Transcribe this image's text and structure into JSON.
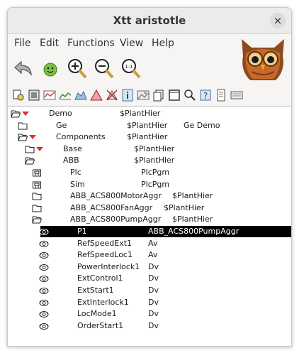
{
  "window": {
    "title": "Xtt aristotle",
    "close_glyph": "×"
  },
  "menu": [
    "File",
    "Edit",
    "Functions",
    "View",
    "Help"
  ],
  "toolbar_big": [
    "back-icon",
    "smiley-icon",
    "zoom-in-icon",
    "zoom-out-icon",
    "zoom-reset-icon"
  ],
  "toolbar_small": [
    "open-object-icon",
    "open-graph-icon",
    "trend-icon",
    "fast-curve-icon",
    "history-icon",
    "alarm-icon",
    "block-alarm-icon",
    "info-icon",
    "open-plc-icon",
    "crossref-icon",
    "window-icon",
    "plc-crossref-icon",
    "help-icon",
    "notes-icon",
    "keyboard-icon"
  ],
  "tree": [
    {
      "name": "Demo",
      "class": "$PlantHier",
      "desc": "",
      "icon": "folder-open",
      "arrow": true
    },
    {
      "name": "Ge",
      "class": "$PlantHier",
      "desc": "Ge Demo",
      "icon": "folder",
      "arrow": false
    },
    {
      "name": "Components",
      "class": "$PlantHier",
      "desc": "",
      "icon": "folder-open",
      "arrow": true
    },
    {
      "name": "Base",
      "class": "$PlantHier",
      "desc": "",
      "icon": "folder",
      "arrow": true
    },
    {
      "name": "ABB",
      "class": "$PlantHier",
      "desc": "",
      "icon": "folder-open",
      "arrow": false
    },
    {
      "name": "Plc",
      "class": "PlcPgm",
      "desc": "",
      "icon": "plc",
      "arrow": false
    },
    {
      "name": "Sim",
      "class": "PlcPgm",
      "desc": "",
      "icon": "plc",
      "arrow": false
    },
    {
      "name": "ABB_ACS800MotorAggr",
      "class": "$PlantHier",
      "desc": "",
      "icon": "folder",
      "arrow": false
    },
    {
      "name": "ABB_ACS800FanAggr",
      "class": "$PlantHier",
      "desc": "",
      "icon": "folder",
      "arrow": false
    },
    {
      "name": "ABB_ACS800PumpAggr",
      "class": "$PlantHier",
      "desc": "",
      "icon": "folder-open",
      "arrow": false
    },
    {
      "name": "P1",
      "class": "ABB_ACS800PumpAggr",
      "desc": "",
      "icon": "object",
      "arrow": false,
      "selected": true
    },
    {
      "name": "RefSpeedExt1",
      "class": "Av",
      "desc": "",
      "icon": "object",
      "arrow": false
    },
    {
      "name": "RefSpeedLoc1",
      "class": "Av",
      "desc": "",
      "icon": "object",
      "arrow": false
    },
    {
      "name": "PowerInterlock1",
      "class": "Dv",
      "desc": "",
      "icon": "object",
      "arrow": false
    },
    {
      "name": "ExtControl1",
      "class": "Dv",
      "desc": "",
      "icon": "object",
      "arrow": false
    },
    {
      "name": "ExtStart1",
      "class": "Dv",
      "desc": "",
      "icon": "object",
      "arrow": false
    },
    {
      "name": "ExtInterlock1",
      "class": "Dv",
      "desc": "",
      "icon": "object",
      "arrow": false
    },
    {
      "name": "LocMode1",
      "class": "Dv",
      "desc": "",
      "icon": "object",
      "arrow": false
    },
    {
      "name": "OrderStart1",
      "class": "Dv",
      "desc": "",
      "icon": "object",
      "arrow": false
    }
  ]
}
